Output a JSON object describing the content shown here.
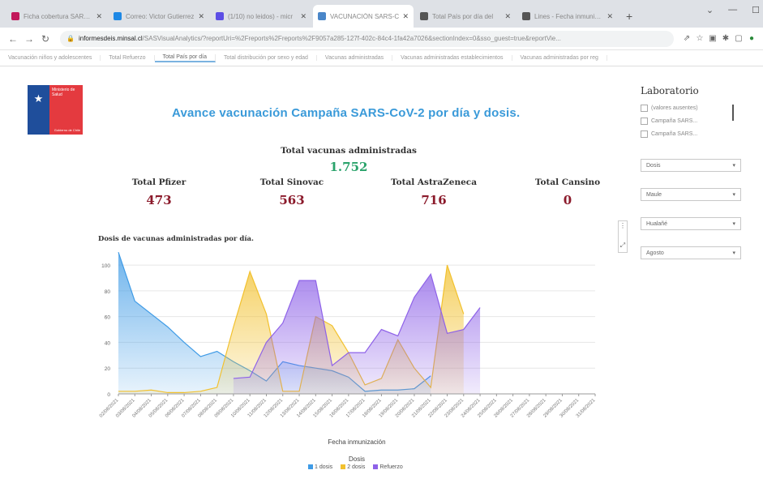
{
  "browser": {
    "tabs": [
      {
        "label": "Ficha cobertura SARS-C",
        "color": "#c2185b",
        "active": false
      },
      {
        "label": "Correo: Victor Gutierrez",
        "color": "#1e88e5",
        "active": false
      },
      {
        "label": "(1/10) no leidos) - micr",
        "color": "#5c4ee5",
        "active": false
      },
      {
        "label": "VACUNACIÓN SARS-C",
        "color": "#4a86c8",
        "active": true
      },
      {
        "label": "Total País por día del",
        "color": "#555555",
        "active": false
      },
      {
        "label": "Lines - Fecha inmunizac",
        "color": "#555555",
        "active": false
      }
    ],
    "new_tab_glyph": "+",
    "window_controls": [
      "⌄",
      "—",
      "☐"
    ],
    "url_host": "informesdeis.minsal.cl",
    "url_path": "/SASVisualAnalytics/?reportUri=%2Freports%2Freports%2F9057a285-127f-402c-84c4-1fa42a7026&sectionIndex=0&sso_guest=true&reportVie..."
  },
  "report_tabs": [
    {
      "label": "Vacunación niños y adolescentes",
      "active": false
    },
    {
      "label": "Total Refuerzo",
      "active": false
    },
    {
      "label": "Total País por día",
      "active": true
    },
    {
      "label": "Total distribución por sexo y edad",
      "active": false
    },
    {
      "label": "Vacunas administradas",
      "active": false
    },
    {
      "label": "Vacunas administradas establecimientos",
      "active": false
    },
    {
      "label": "Vacunas administradas por reg",
      "active": false
    }
  ],
  "logo": {
    "ministry": "Ministerio de Salud",
    "gov": "Gobierno de Chile"
  },
  "header": {
    "title": "Avance vacunación Campaña SARS-CoV-2 por día y dosis."
  },
  "kpis": {
    "total": {
      "label": "Total vacunas administradas",
      "value": "1.752"
    },
    "pfizer": {
      "label": "Total Pfizer",
      "value": "473"
    },
    "sinovac": {
      "label": "Total Sinovac",
      "value": "563"
    },
    "astrazeneca": {
      "label": "Total AstraZeneca",
      "value": "716"
    },
    "cansino": {
      "label": "Total Cansino",
      "value": "0"
    }
  },
  "filters": {
    "laboratorio_title": "Laboratorio",
    "laboratorio_options": [
      "(valores ausentes)",
      "Campaña SARS...",
      "Campaña SARS..."
    ],
    "dosis": "Dosis",
    "region": "Maule",
    "comuna": "Hualañé",
    "mes": "Agosto"
  },
  "chart_data": {
    "type": "area",
    "title": "Dosis de vacunas administradas por día.",
    "xlabel": "Fecha inmunización",
    "ylabel": "",
    "x": [
      "02/08/2021",
      "03/08/2021",
      "04/08/2021",
      "05/08/2021",
      "06/08/2021",
      "07/08/2021",
      "08/08/2021",
      "09/08/2021",
      "10/08/2021",
      "11/08/2021",
      "12/08/2021",
      "13/08/2021",
      "14/08/2021",
      "15/08/2021",
      "16/08/2021",
      "17/08/2021",
      "18/08/2021",
      "19/08/2021",
      "20/08/2021",
      "21/08/2021",
      "22/08/2021",
      "23/08/2021",
      "24/08/2021",
      "25/08/2021",
      "26/08/2021",
      "27/08/2021",
      "28/08/2021",
      "29/08/2021",
      "30/08/2021",
      "31/08/2021"
    ],
    "yticks": [
      0,
      20,
      40,
      60,
      80,
      100
    ],
    "ylim": [
      0,
      112
    ],
    "legend_title": "Dosis",
    "series": [
      {
        "name": "1 dosis",
        "color": "#3f9be6",
        "values": [
          110,
          72,
          62,
          52,
          40,
          29,
          33,
          25,
          18,
          10,
          25,
          22,
          20,
          18,
          13,
          2,
          3,
          3,
          4,
          14
        ]
      },
      {
        "name": "2 dosis",
        "color": "#f2c12e",
        "values": [
          2,
          2,
          3,
          1,
          1,
          2,
          5,
          52,
          95,
          62,
          2,
          2,
          60,
          53,
          32,
          7,
          12,
          42,
          20,
          5,
          100,
          62
        ]
      },
      {
        "name": "Refuerzo",
        "color": "#8e62e8",
        "values": [
          12,
          13,
          40,
          55,
          88,
          88,
          22,
          32,
          32,
          50,
          45,
          75,
          93,
          47,
          50,
          67
        ]
      }
    ]
  }
}
